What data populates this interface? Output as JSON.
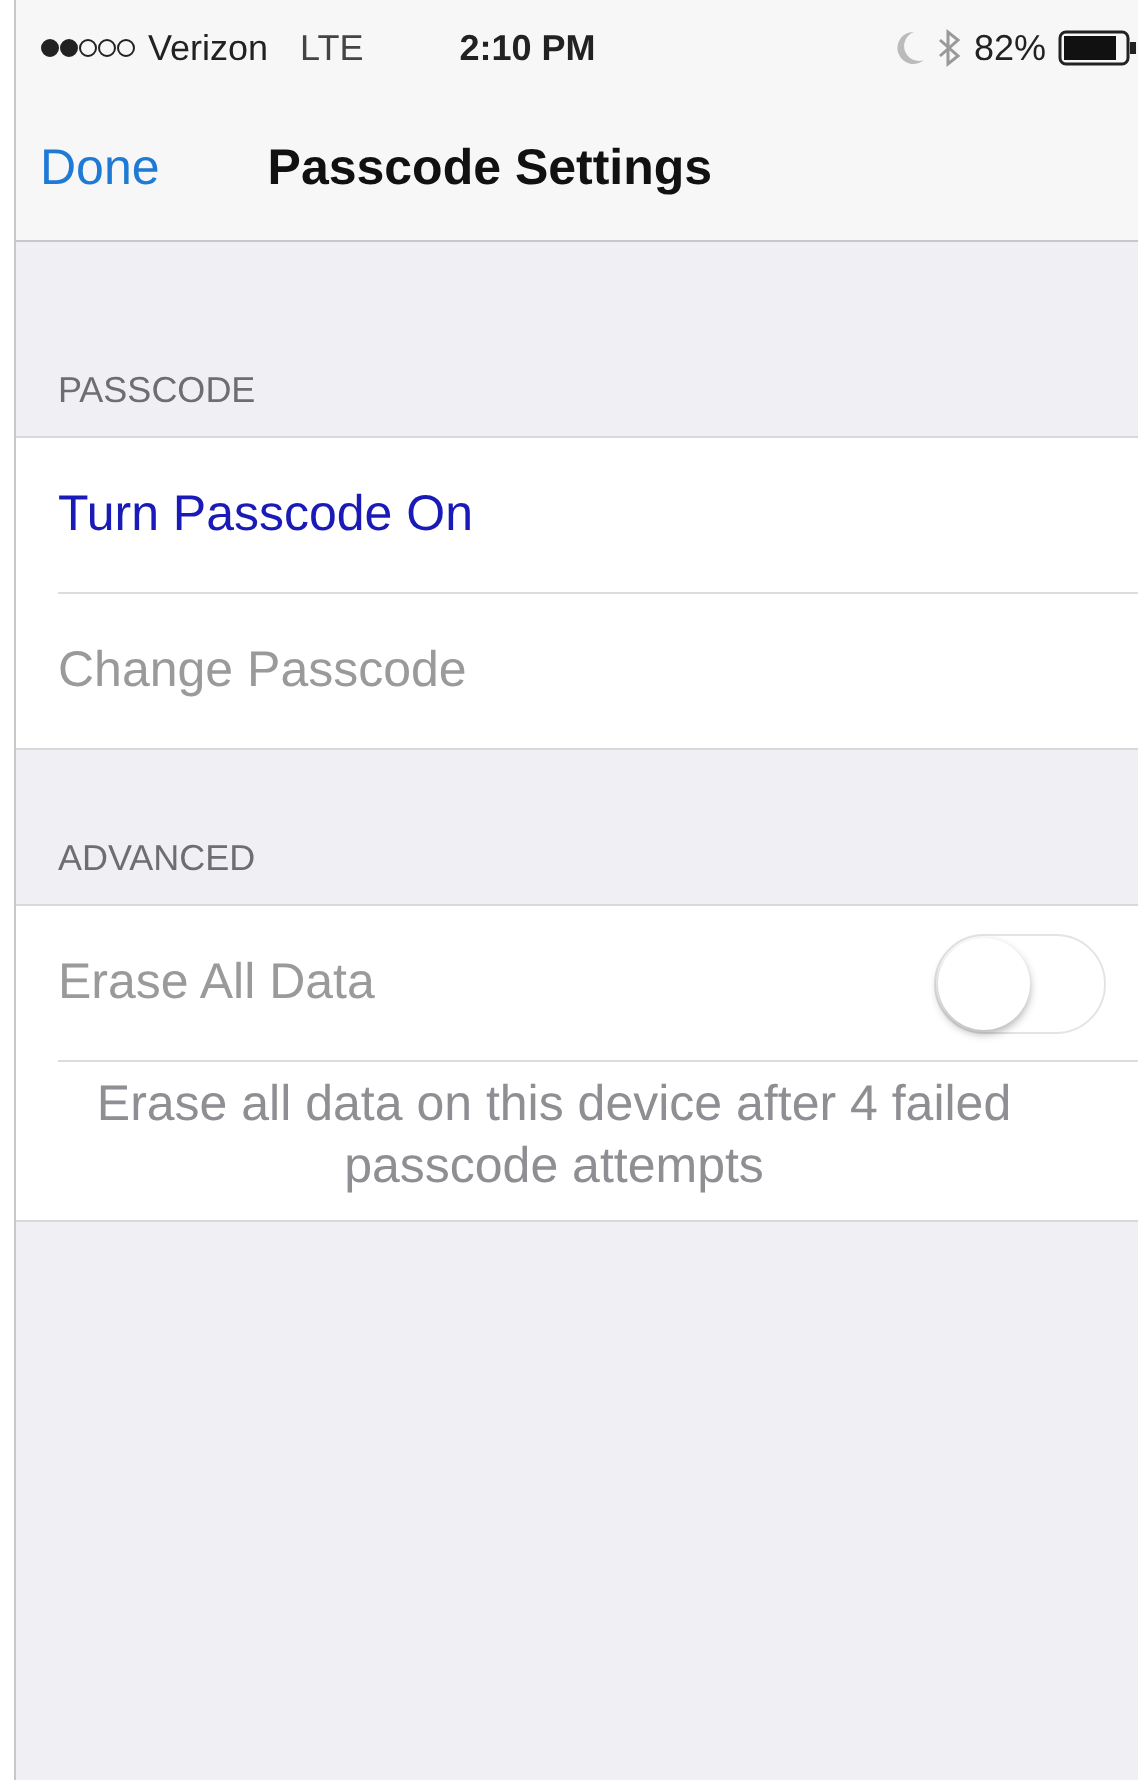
{
  "status_bar": {
    "carrier": "Verizon",
    "network": "LTE",
    "time": "2:10 PM",
    "battery": "82%"
  },
  "nav": {
    "back": "Done",
    "title": "Passcode Settings"
  },
  "sections": [
    {
      "header": "PASSCODE",
      "rows": [
        {
          "kind": "link",
          "label": "Turn Passcode On",
          "disabled": false
        },
        {
          "kind": "link",
          "label": "Change Passcode",
          "disabled": true
        }
      ]
    },
    {
      "header": "ADVANCED",
      "rows": [
        {
          "kind": "toggle",
          "label": "Erase All Data",
          "disabled": true,
          "on": false
        },
        {
          "kind": "note",
          "label": "Erase all data on this device after 4 failed passcode attempts"
        }
      ]
    }
  ]
}
